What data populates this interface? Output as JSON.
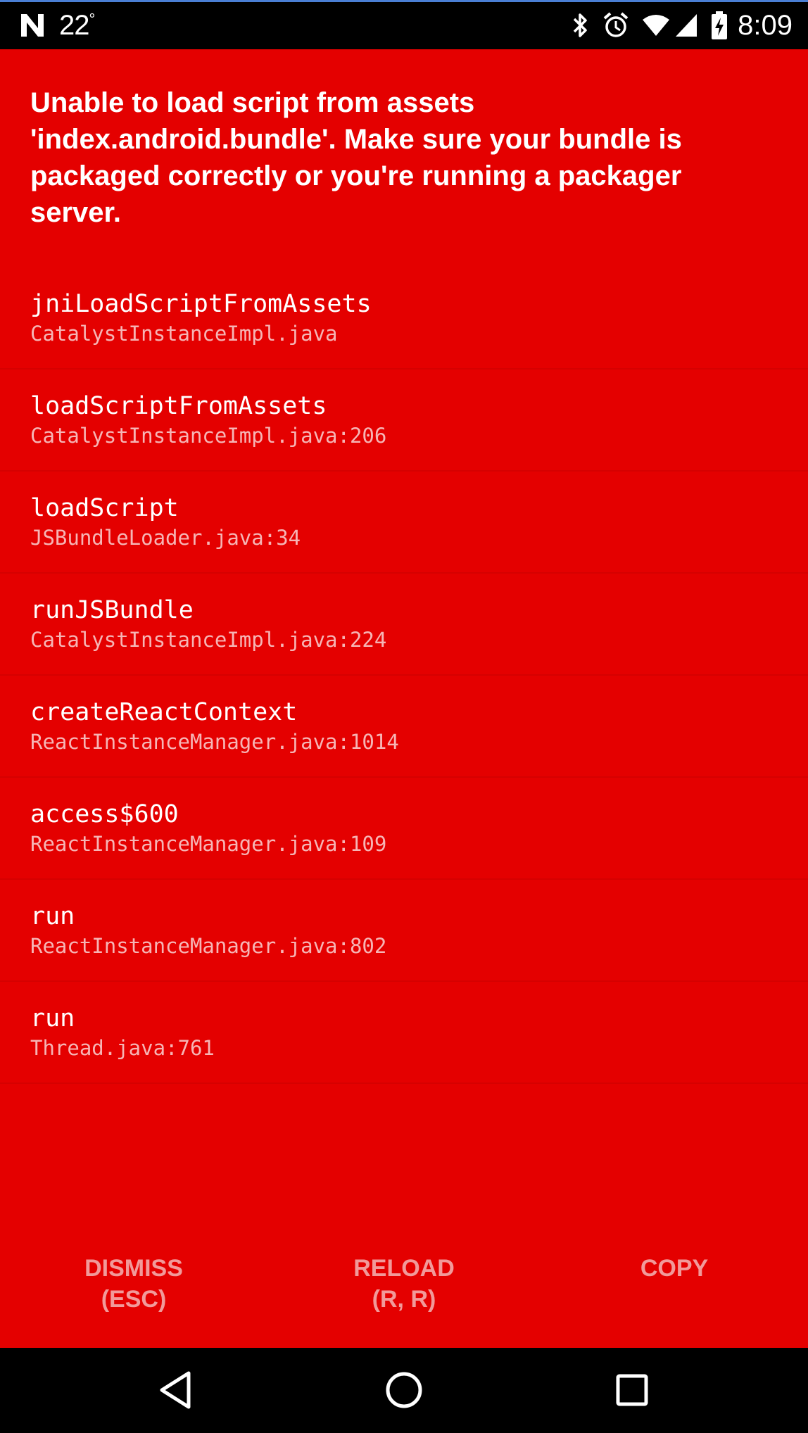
{
  "status_bar": {
    "notification_icon": "n-notification-icon",
    "temperature": "22",
    "temperature_unit": "°",
    "icons": [
      "bluetooth-icon",
      "alarm-icon",
      "wifi-icon",
      "cell-signal-icon",
      "battery-charging-icon"
    ],
    "time": "8:09"
  },
  "error": {
    "message": "Unable to load script from assets 'index.android.bundle'. Make sure your bundle is packaged correctly or you're running a packager server."
  },
  "stack_frames": [
    {
      "method": "jniLoadScriptFromAssets",
      "file": "CatalystInstanceImpl.java"
    },
    {
      "method": "loadScriptFromAssets",
      "file": "CatalystInstanceImpl.java:206"
    },
    {
      "method": "loadScript",
      "file": "JSBundleLoader.java:34"
    },
    {
      "method": "runJSBundle",
      "file": "CatalystInstanceImpl.java:224"
    },
    {
      "method": "createReactContext",
      "file": "ReactInstanceManager.java:1014"
    },
    {
      "method": "access$600",
      "file": "ReactInstanceManager.java:109"
    },
    {
      "method": "run",
      "file": "ReactInstanceManager.java:802"
    },
    {
      "method": "run",
      "file": "Thread.java:761"
    }
  ],
  "actions": {
    "dismiss": {
      "line1": "DISMISS",
      "line2": "(ESC)"
    },
    "reload": {
      "line1": "RELOAD",
      "line2": "(R, R)"
    },
    "copy": {
      "line1": "COPY"
    }
  },
  "nav_bar": {
    "icons": [
      "back-icon",
      "home-icon",
      "recents-icon"
    ]
  },
  "colors": {
    "background": "#e40000",
    "text": "#ffffff",
    "file_text": "#f6b5b5",
    "action_text": "#f19a9a",
    "bars": "#000000"
  }
}
